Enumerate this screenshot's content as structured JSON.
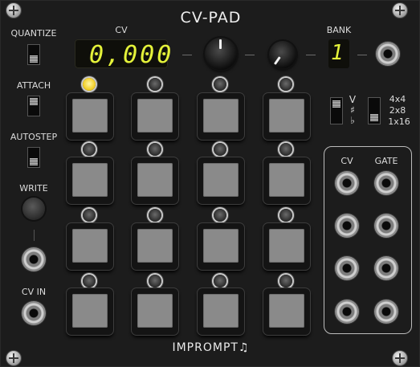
{
  "module": {
    "title": "CV-PAD",
    "brand": "IMPROMPT",
    "brand_glyph": "♫"
  },
  "left_column": {
    "quantize": "QUANTIZE",
    "attach": "ATTACH",
    "autostep": "AUTOSTEP",
    "write": "WRITE",
    "cv_in": "CV IN"
  },
  "cv_display": {
    "label": "CV",
    "value": "0,000",
    "ghost": "8.888",
    "color": "#e5f33a"
  },
  "bank": {
    "label": "BANK",
    "value": "1"
  },
  "switches": {
    "volt": "V",
    "sharp": "♯",
    "flat": "♭",
    "configs": [
      "4x4",
      "2x8",
      "1x16"
    ]
  },
  "outputs": {
    "cv": "CV",
    "gate": "GATE"
  },
  "pads": {
    "active_index": 0,
    "led_on_color": "#f2cf28"
  }
}
